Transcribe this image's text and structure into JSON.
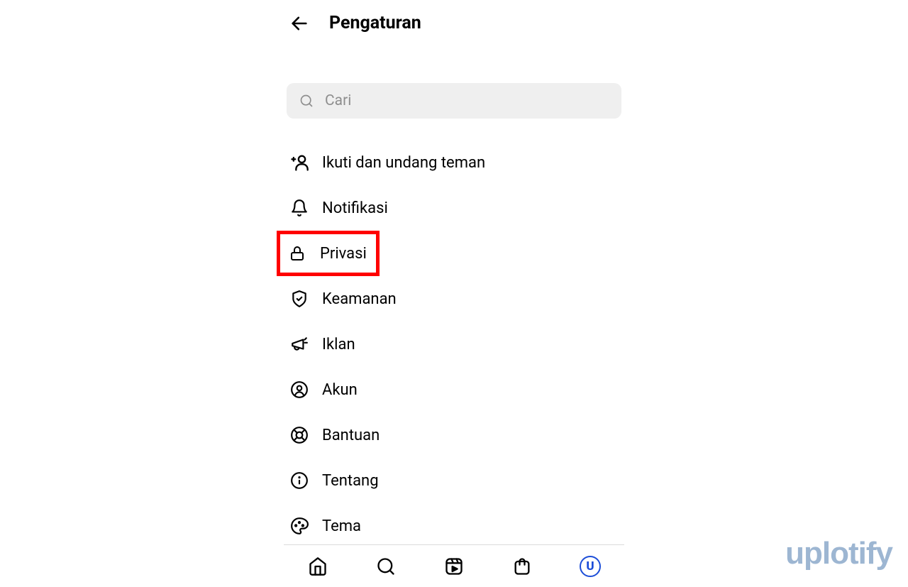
{
  "header": {
    "title": "Pengaturan"
  },
  "search": {
    "placeholder": "Cari"
  },
  "menu": {
    "items": [
      {
        "label": "Ikuti dan undang teman"
      },
      {
        "label": "Notifikasi"
      },
      {
        "label": "Privasi"
      },
      {
        "label": "Keamanan"
      },
      {
        "label": "Iklan"
      },
      {
        "label": "Akun"
      },
      {
        "label": "Bantuan"
      },
      {
        "label": "Tentang"
      },
      {
        "label": "Tema"
      }
    ]
  },
  "bottom_nav": {
    "profile_letter": "U"
  },
  "watermark": "uplotify",
  "highlighted_index": 2
}
